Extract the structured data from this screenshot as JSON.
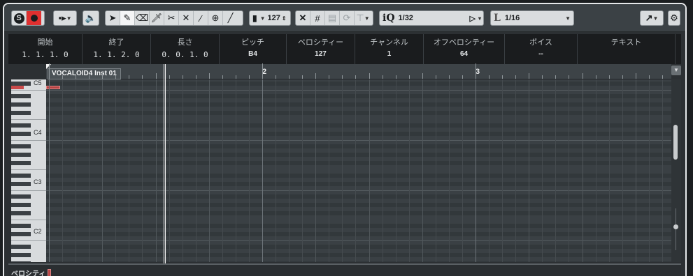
{
  "toolbar": {
    "velocity_value": "127",
    "quantize_value": "1/32",
    "length_value": "1/16",
    "quantize_label": "iQ",
    "length_prefix": "L"
  },
  "infoline": {
    "columns": [
      {
        "header": "開始",
        "value": "1. 1. 1.   0"
      },
      {
        "header": "終了",
        "value": "1. 1. 2.   0"
      },
      {
        "header": "長さ",
        "value": "0. 0. 1.   0"
      },
      {
        "header": "ピッチ",
        "value": "B4"
      },
      {
        "header": "ベロシティー",
        "value": "127"
      },
      {
        "header": "チャンネル",
        "value": "1"
      },
      {
        "header": "オフベロシティー",
        "value": "64"
      },
      {
        "header": "ボイス",
        "value": "--"
      },
      {
        "header": "テキスト",
        "value": ""
      }
    ]
  },
  "ruler": {
    "event_name": "VOCALOID4 Inst 01",
    "bars": [
      "2",
      "3"
    ]
  },
  "keyboard": {
    "notes": [
      "C5",
      "C4",
      "C3",
      "C2"
    ]
  },
  "velocity_lane": {
    "title": "ベロシティ"
  }
}
